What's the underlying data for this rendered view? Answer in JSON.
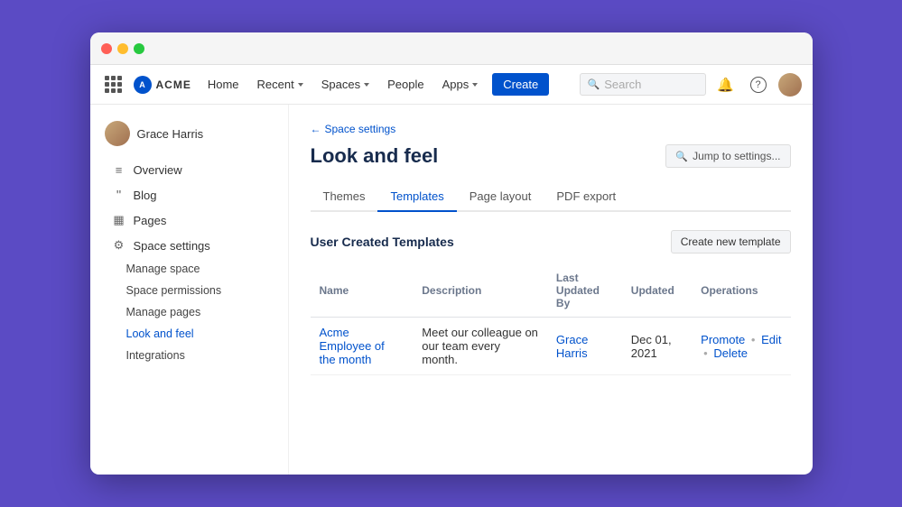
{
  "window": {
    "titlebar": {
      "buttons": [
        "red",
        "yellow",
        "green"
      ]
    }
  },
  "topnav": {
    "logo_text": "ACME",
    "links": [
      {
        "label": "Home",
        "has_chevron": false
      },
      {
        "label": "Recent",
        "has_chevron": true
      },
      {
        "label": "Spaces",
        "has_chevron": true
      },
      {
        "label": "People",
        "has_chevron": false
      },
      {
        "label": "Apps",
        "has_chevron": true
      }
    ],
    "create_label": "Create",
    "search_placeholder": "Search",
    "notification_icon": "🔔",
    "help_icon": "?"
  },
  "sidebar": {
    "username": "Grace Harris",
    "nav_items": [
      {
        "label": "Overview",
        "icon": "≡"
      },
      {
        "label": "Blog",
        "icon": "❝"
      }
    ],
    "pages_item": {
      "label": "Pages",
      "icon": "▦"
    },
    "space_settings_item": {
      "label": "Space settings",
      "icon": "⚙"
    },
    "submenu_items": [
      {
        "label": "Manage space",
        "active": false
      },
      {
        "label": "Space permissions",
        "active": false
      },
      {
        "label": "Manage pages",
        "active": false
      },
      {
        "label": "Look and feel",
        "active": true
      },
      {
        "label": "Integrations",
        "active": false
      }
    ]
  },
  "breadcrumb": {
    "label": "Space settings"
  },
  "page": {
    "title": "Look and feel",
    "jump_settings_label": "Jump to settings...",
    "tabs": [
      {
        "label": "Themes",
        "active": false
      },
      {
        "label": "Templates",
        "active": true
      },
      {
        "label": "Page layout",
        "active": false
      },
      {
        "label": "PDF export",
        "active": false
      }
    ]
  },
  "templates_section": {
    "title": "User Created Templates",
    "create_btn_label": "Create new template",
    "table": {
      "columns": [
        "Name",
        "Description",
        "Last Updated By",
        "Updated",
        "Operations"
      ],
      "rows": [
        {
          "name": "Acme Employee of the month",
          "description": "Meet our colleague on our team every month.",
          "last_updated_by": "Grace Harris",
          "updated": "Dec 01, 2021",
          "operations": [
            "Promote",
            "Edit",
            "Delete"
          ]
        }
      ]
    }
  }
}
